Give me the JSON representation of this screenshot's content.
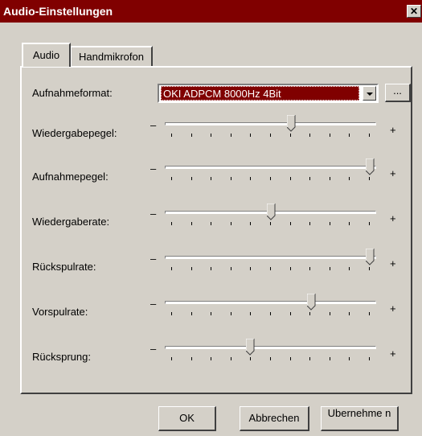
{
  "window": {
    "title": "Audio-Einstellungen",
    "close_glyph": "✕"
  },
  "tabs": [
    {
      "label": "Audio",
      "active": true
    },
    {
      "label": "Handmikrofon",
      "active": false
    }
  ],
  "format": {
    "label": "Aufnahmeformat:",
    "value": "OKI ADPCM 8000Hz 4Bit",
    "more_label": "..."
  },
  "slider_signs": {
    "minus": "–",
    "plus": "+"
  },
  "sliders": [
    {
      "label": "Wiedergabepegel:",
      "value": 0.61
    },
    {
      "label": "Aufnahmepegel:",
      "value": 1.0
    },
    {
      "label": "Wiedergaberate:",
      "value": 0.51
    },
    {
      "label": "Rückspulrate:",
      "value": 1.0
    },
    {
      "label": "Vorspulrate:",
      "value": 0.71
    },
    {
      "label": "Rücksprung:",
      "value": 0.41
    }
  ],
  "buttons": {
    "ok": "OK",
    "cancel": "Abbrechen",
    "apply": "Ubernehme n"
  }
}
